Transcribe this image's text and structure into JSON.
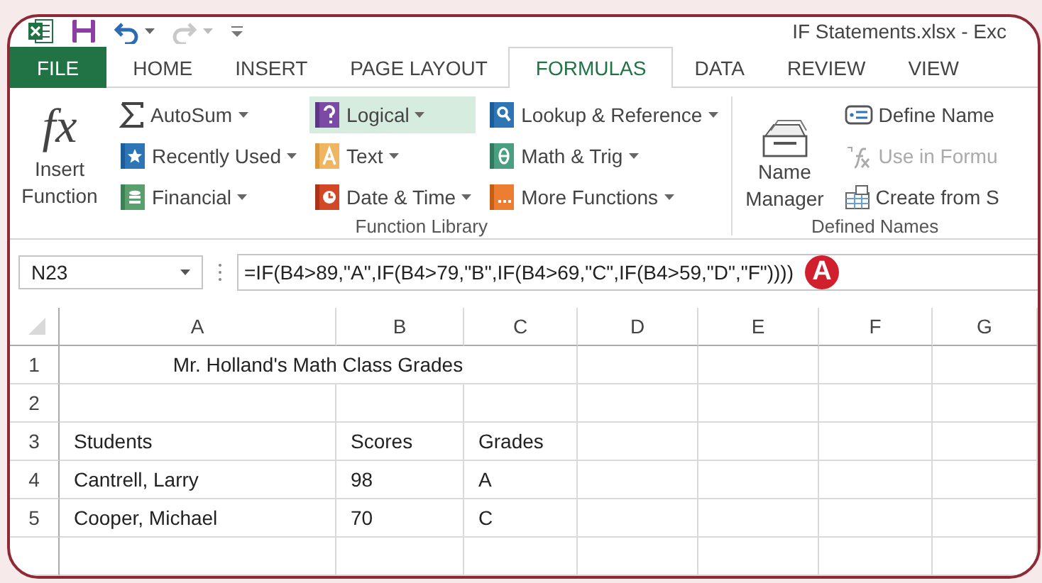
{
  "window": {
    "title": "IF Statements.xlsx - Exc"
  },
  "tabs": [
    {
      "label": "FILE",
      "kind": "file",
      "selected": false
    },
    {
      "label": "HOME",
      "kind": "tab",
      "selected": false
    },
    {
      "label": "INSERT",
      "kind": "tab",
      "selected": false
    },
    {
      "label": "PAGE LAYOUT",
      "kind": "tab",
      "selected": false
    },
    {
      "label": "FORMULAS",
      "kind": "tab",
      "selected": true
    },
    {
      "label": "DATA",
      "kind": "tab",
      "selected": false
    },
    {
      "label": "REVIEW",
      "kind": "tab",
      "selected": false
    },
    {
      "label": "VIEW",
      "kind": "tab",
      "selected": false
    }
  ],
  "ribbon": {
    "insert_function": {
      "icon_text": "fx",
      "label": "Insert Function"
    },
    "function_library": {
      "label": "Function Library",
      "columns": [
        [
          {
            "label": "AutoSum",
            "kind": "sum",
            "selected": false
          },
          {
            "label": "Recently Used",
            "kind": "recent",
            "selected": false
          },
          {
            "label": "Financial",
            "kind": "financial",
            "selected": false
          }
        ],
        [
          {
            "label": "Logical",
            "kind": "logical",
            "selected": true
          },
          {
            "label": "Text",
            "kind": "text",
            "selected": false
          },
          {
            "label": "Date & Time",
            "kind": "date",
            "selected": false
          }
        ],
        [
          {
            "label": "Lookup & Reference",
            "kind": "lookup",
            "selected": false
          },
          {
            "label": "Math & Trig",
            "kind": "math",
            "selected": false
          },
          {
            "label": "More Functions",
            "kind": "more",
            "selected": false
          }
        ]
      ]
    },
    "defined_names": {
      "label": "Defined Names",
      "name_manager": "Name Manager",
      "items": [
        {
          "label": "Define Name",
          "kind": "define",
          "disabled": false
        },
        {
          "label": "Use in Formu",
          "kind": "use",
          "disabled": true
        },
        {
          "label": "Create from S",
          "kind": "create",
          "disabled": false
        }
      ]
    }
  },
  "formula_bar": {
    "name_box": "N23",
    "formula": "=IF(B4>89,\"A\",IF(B4>79,\"B\",IF(B4>69,\"C\",IF(B4>59,\"D\",\"F\"))))",
    "callout": "A"
  },
  "sheet": {
    "columns": [
      "A",
      "B",
      "C",
      "D",
      "E",
      "F",
      "G"
    ],
    "rows": [
      {
        "number": "1",
        "title": "Mr. Holland's Math Class Grades"
      },
      {
        "number": "2"
      },
      {
        "number": "3",
        "cells": [
          "Students",
          "Scores",
          "Grades"
        ]
      },
      {
        "number": "4",
        "cells": [
          "Cantrell, Larry",
          "98",
          "A"
        ]
      },
      {
        "number": "5",
        "cells": [
          "Cooper, Michael",
          "70",
          "C"
        ]
      }
    ]
  }
}
